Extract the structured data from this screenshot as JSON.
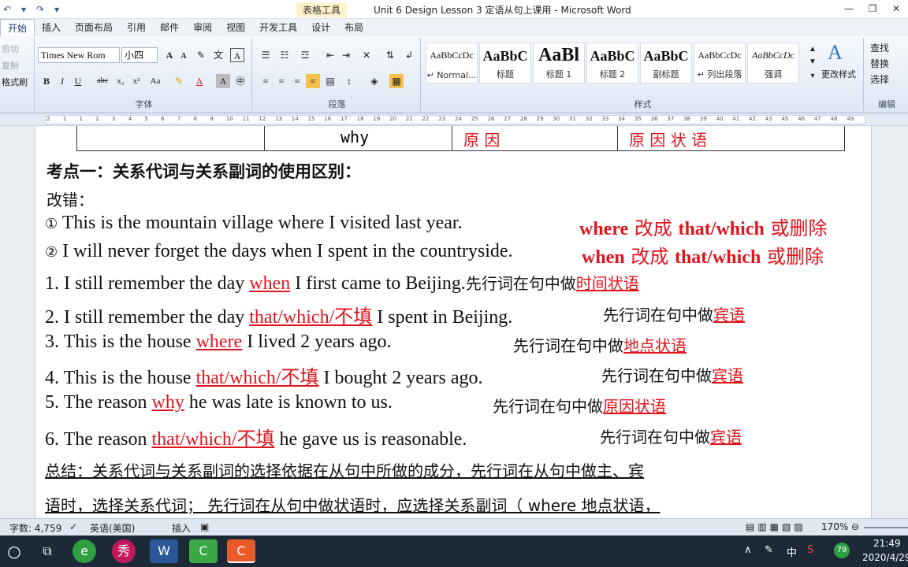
{
  "titlebar": {
    "qat": [
      "↶",
      "▾",
      "↷",
      "▾"
    ],
    "context_tab": "表格工具",
    "title": "Unit 6 Design Lesson 3 定语从句上课用 - Microsoft Word",
    "controls": [
      "—",
      "❐",
      "✕"
    ]
  },
  "menu": [
    "开始",
    "插入",
    "页面布局",
    "引用",
    "邮件",
    "审阅",
    "视图",
    "开发工具",
    "设计",
    "布局"
  ],
  "ribbon": {
    "clipboard": {
      "cut": "剪切",
      "copy": "复制",
      "format_painter": "格式刷"
    },
    "font": {
      "name": "Times New Rom",
      "size": "小四",
      "grow": "A",
      "shrink": "A",
      "bold": "B",
      "italic": "I",
      "underline": "U",
      "strike": "abc",
      "sub": "x₂",
      "sup": "x²",
      "case": "Aa",
      "label": "字体"
    },
    "paragraph": {
      "label": "段落"
    },
    "styles": {
      "items": [
        {
          "sample": "AaBbCcDc",
          "name": "↵ Normal..."
        },
        {
          "sample": "AaBbC",
          "name": "标题"
        },
        {
          "sample": "AaBl",
          "name": "标题 1"
        },
        {
          "sample": "AaBbC",
          "name": "标题 2"
        },
        {
          "sample": "AaBbC",
          "name": "副标题"
        },
        {
          "sample": "AaBbCcDc",
          "name": "↵ 列出段落"
        },
        {
          "sample": "AaBbCcDc",
          "name": "强调"
        }
      ],
      "change": "更改样式",
      "label": "样式"
    },
    "editing": {
      "find": "查找",
      "replace": "替换",
      "select": "选择",
      "label": "编辑"
    }
  },
  "ruler": [
    "2",
    "1",
    "1",
    "2",
    "3",
    "4",
    "5",
    "6",
    "7",
    "8",
    "9",
    "10",
    "11",
    "12",
    "13",
    "14",
    "15",
    "16",
    "17",
    "18",
    "19",
    "20",
    "21",
    "22",
    "23",
    "24",
    "25",
    "26",
    "27",
    "28",
    "29",
    "30",
    "31",
    "32",
    "33",
    "34",
    "35",
    "36",
    "37",
    "38",
    "39",
    "40",
    "41",
    "42",
    "43",
    "45",
    "46",
    "47",
    "48",
    "49"
  ],
  "doc": {
    "table_row": {
      "c2": "why",
      "c3": "原 因",
      "c4": "原 因 状 语"
    },
    "heading": "考点一：关系代词与关系副词的使用区别：",
    "gaicuo": "改错：",
    "e1": {
      "num": "①",
      "text": "This is the mountain village where I visited last year.",
      "fix1": "where",
      "fix2": " 改成 ",
      "fix3": "that/which",
      "fix4": "  或删除"
    },
    "e2": {
      "num": "②",
      "text": "I will never forget the days when I spent in the countryside.",
      "fix1": "when",
      "fix2": " 改成 ",
      "fix3": "that/which",
      "fix4": "  或删除"
    },
    "l1": {
      "pre": "1. I still remember the day ",
      "ans": "when",
      "post": " I first came to Beijing.",
      "note": "先行词在句中做",
      "role": "时间状语"
    },
    "l2": {
      "pre": "2. I still remember the day ",
      "ans": "that/which/不填",
      "post": "  I spent in Beijing.",
      "note": "先行词在句中做",
      "role": "宾语"
    },
    "l3": {
      "pre": "3. This is the house ",
      "ans": "where",
      "post": " I lived 2 years ago.",
      "note": "先行词在句中做",
      "role": "地点状语"
    },
    "l4": {
      "pre": "4. This is the house ",
      "ans": "that/which/不填",
      "post": "  I bought 2 years ago.",
      "note": "先行词在句中做",
      "role": "宾语"
    },
    "l5": {
      "pre": "5. The reason ",
      "ans": "why",
      "post": " he was late is known to us.",
      "note": "先行词在句中做",
      "role": "原因状语"
    },
    "l6": {
      "pre": "6. The reason ",
      "ans": "that/which/不填",
      "post": " he gave us is reasonable.",
      "note": "先行词在句中做",
      "role": "宾语"
    },
    "summary1": "总结：关系代词与关系副词的选择依据在从句中所做的成分，先行词在从句中做主、宾",
    "summary2": "语时，选择关系代词；  先行词在从句中做状语时，应选择关系副词（ where  地点状语，"
  },
  "status": {
    "words": "字数: 4,759",
    "lang": "英语(美国)",
    "mode": "插入",
    "zoom": "170%"
  },
  "taskbar": {
    "time": "21:49",
    "date": "2020/4/29",
    "ime": "中",
    "badge": "79"
  }
}
